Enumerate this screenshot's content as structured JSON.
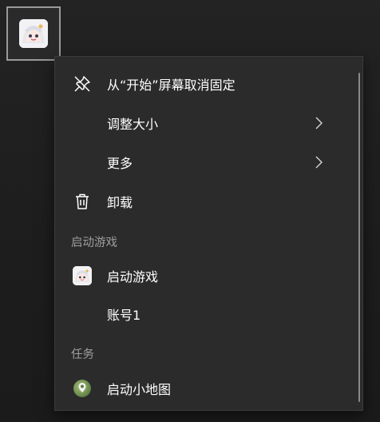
{
  "tile": {
    "icon": "paimon-app-icon"
  },
  "menu": {
    "items": [
      {
        "label": "从“开始”屏幕取消固定",
        "icon": "unpin-icon"
      },
      {
        "label": "调整大小",
        "submenu": true
      },
      {
        "label": "更多",
        "submenu": true
      },
      {
        "label": "卸载",
        "icon": "trash-icon"
      }
    ],
    "section_launch": "启动游戏",
    "launch_items": [
      {
        "label": "启动游戏",
        "icon": "paimon-app-icon"
      },
      {
        "label": "账号1"
      }
    ],
    "section_tasks": "任务",
    "task_items": [
      {
        "label": "启动小地图",
        "icon": "minimap-icon"
      }
    ]
  },
  "colors": {
    "menu_bg": "#2b2b2b",
    "section_text": "#9e9e9e",
    "text": "#ffffff"
  }
}
